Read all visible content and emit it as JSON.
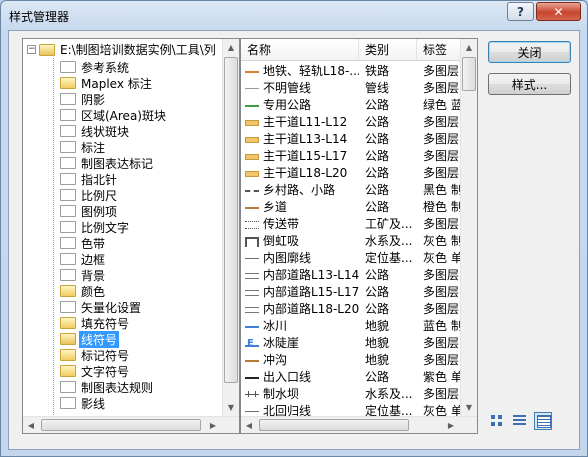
{
  "window": {
    "title": "样式管理器",
    "help": "?",
    "close": "✕"
  },
  "tree": {
    "root": "E:\\制图培训数据实例\\工具\\列",
    "items": [
      {
        "label": "参考系统",
        "icon": "empty"
      },
      {
        "label": "Maplex 标注",
        "icon": "full"
      },
      {
        "label": "阴影",
        "icon": "empty"
      },
      {
        "label": "区域(Area)斑块",
        "icon": "empty"
      },
      {
        "label": "线状斑块",
        "icon": "empty"
      },
      {
        "label": "标注",
        "icon": "empty"
      },
      {
        "label": "制图表达标记",
        "icon": "empty"
      },
      {
        "label": "指北针",
        "icon": "empty"
      },
      {
        "label": "比例尺",
        "icon": "empty"
      },
      {
        "label": "图例项",
        "icon": "empty"
      },
      {
        "label": "比例文字",
        "icon": "empty"
      },
      {
        "label": "色带",
        "icon": "empty"
      },
      {
        "label": "边框",
        "icon": "empty"
      },
      {
        "label": "背景",
        "icon": "empty"
      },
      {
        "label": "颜色",
        "icon": "full"
      },
      {
        "label": "矢量化设置",
        "icon": "empty"
      },
      {
        "label": "填充符号",
        "icon": "full"
      },
      {
        "label": "线符号",
        "icon": "open",
        "selected": true
      },
      {
        "label": "标记符号",
        "icon": "full"
      },
      {
        "label": "文字符号",
        "icon": "full"
      },
      {
        "label": "制图表达规则",
        "icon": "empty"
      },
      {
        "label": "影线",
        "icon": "empty"
      }
    ]
  },
  "list": {
    "columns": [
      "名称",
      "类别",
      "标签"
    ],
    "rows": [
      {
        "name": "地铁、轻轨L18-...",
        "category": "铁路",
        "tags": "多图层",
        "symbol": "orange"
      },
      {
        "name": "不明管线",
        "category": "管线",
        "tags": "多图层",
        "symbol": "gray"
      },
      {
        "name": "专用公路",
        "category": "公路",
        "tags": "绿色 蓝",
        "symbol": "green"
      },
      {
        "name": "主干道L11-L12",
        "category": "公路",
        "tags": "多图层",
        "symbol": "thick"
      },
      {
        "name": "主干道L13-L14",
        "category": "公路",
        "tags": "多图层",
        "symbol": "thick"
      },
      {
        "name": "主干道L15-L17",
        "category": "公路",
        "tags": "多图层",
        "symbol": "thick"
      },
      {
        "name": "主干道L18-L20",
        "category": "公路",
        "tags": "多图层",
        "symbol": "thick"
      },
      {
        "name": "乡村路、小路",
        "category": "公路",
        "tags": "黑色 制",
        "symbol": "dash"
      },
      {
        "name": "乡道",
        "category": "公路",
        "tags": "橙色 制",
        "symbol": "brown"
      },
      {
        "name": "传送带",
        "category": "工矿及...",
        "tags": "多图层",
        "symbol": "belt"
      },
      {
        "name": "倒虹吸",
        "category": "水系及...",
        "tags": "灰色 制",
        "symbol": "siphon"
      },
      {
        "name": "内图廓线",
        "category": "定位基...",
        "tags": "灰色 单",
        "symbol": "solid"
      },
      {
        "name": "内部道路L13-L14",
        "category": "公路",
        "tags": "多图层",
        "symbol": "double"
      },
      {
        "name": "内部道路L15-L17",
        "category": "公路",
        "tags": "多图层",
        "symbol": "double"
      },
      {
        "name": "内部道路L18-L20",
        "category": "公路",
        "tags": "多图层",
        "symbol": "double"
      },
      {
        "name": "冰川",
        "category": "地貌",
        "tags": "蓝色 制",
        "symbol": "blue"
      },
      {
        "name": "冰陡崖",
        "category": "地貌",
        "tags": "多图层",
        "symbol": "cliff"
      },
      {
        "name": "冲沟",
        "category": "地貌",
        "tags": "多图层",
        "symbol": "brown"
      },
      {
        "name": "出入口线",
        "category": "公路",
        "tags": "紫色 单",
        "symbol": "black"
      },
      {
        "name": "制水坝",
        "category": "水系及...",
        "tags": "多图层",
        "symbol": "ticks"
      },
      {
        "name": "北回归线",
        "category": "定位基...",
        "tags": "灰色 单",
        "symbol": "solid"
      }
    ]
  },
  "buttons": {
    "close": "关闭",
    "styles": "样式..."
  }
}
